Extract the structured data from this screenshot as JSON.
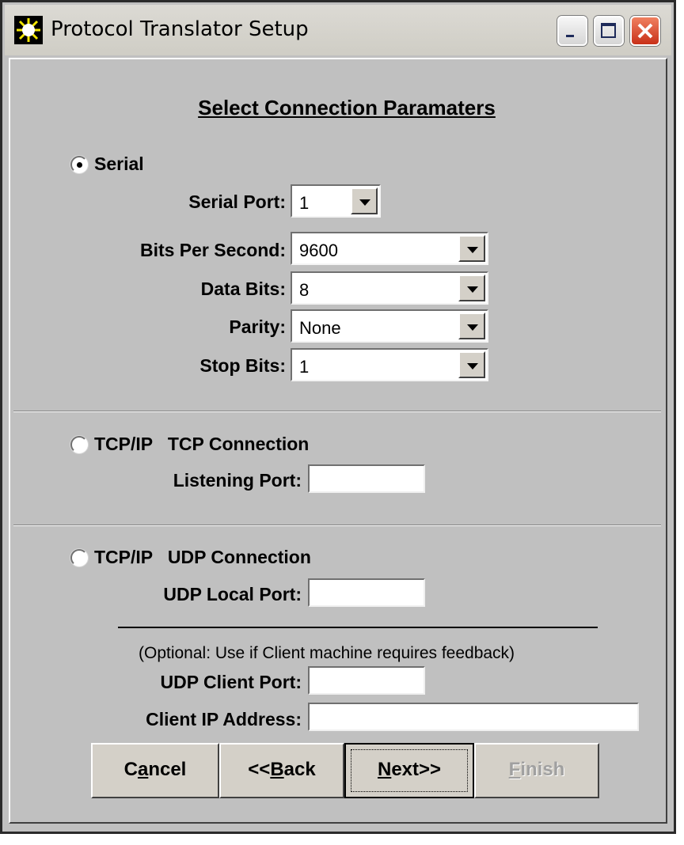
{
  "window": {
    "title": "Protocol Translator Setup"
  },
  "heading": "Select Connection Paramaters",
  "serial": {
    "label": "Serial",
    "selected": true,
    "port_label": "Serial Port:",
    "port_value": "1",
    "bps_label": "Bits Per Second:",
    "bps_value": "9600",
    "databits_label": "Data Bits:",
    "databits_value": "8",
    "parity_label": "Parity:",
    "parity_value": "None",
    "stopbits_label": "Stop Bits:",
    "stopbits_value": "1"
  },
  "tcp": {
    "label": "TCP/IP   TCP Connection",
    "selected": false,
    "listening_label": "Listening Port:",
    "listening_value": ""
  },
  "udp": {
    "label": "TCP/IP   UDP Connection",
    "selected": false,
    "local_label": "UDP Local Port:",
    "local_value": "",
    "note": "(Optional: Use if Client machine requires feedback)",
    "client_port_label": "UDP Client Port:",
    "client_port_value": "",
    "client_ip_label": "Client IP Address:",
    "client_ip_value": ""
  },
  "buttons": {
    "cancel": {
      "pre": "C",
      "accel": "a",
      "post": "ncel"
    },
    "back": {
      "pre": "<<",
      "accel": "B",
      "post": "ack"
    },
    "next": {
      "pre": "",
      "accel": "N",
      "post": "ext>>"
    },
    "finish": {
      "pre": "",
      "accel": "F",
      "post": "inish"
    }
  },
  "colors": {
    "dialog_bg": "#c0c0c0",
    "close_button": "#d8482a"
  }
}
